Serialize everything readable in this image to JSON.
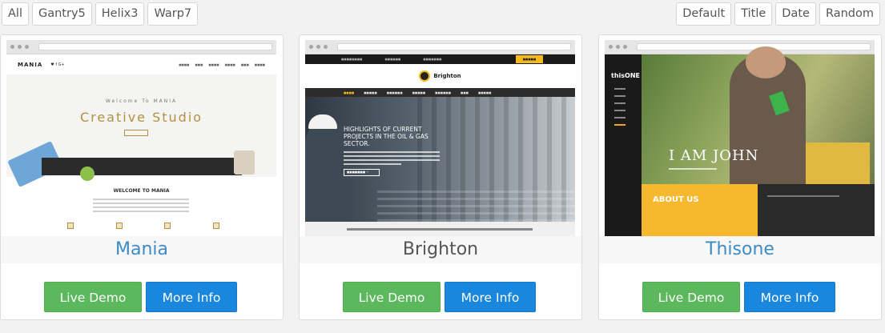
{
  "filters": {
    "left": [
      "All",
      "Gantry5",
      "Helix3",
      "Warp7"
    ],
    "right": [
      "Default",
      "Title",
      "Date",
      "Random"
    ]
  },
  "cards": [
    {
      "title": "Mania",
      "title_color": "#3d8bc5",
      "live_demo_label": "Live Demo",
      "more_info_label": "More Info",
      "thumb": {
        "logo": "MANIA",
        "welcome": "Welcome To MANIA",
        "headline": "Creative Studio",
        "section": "WELCOME TO MANIA"
      }
    },
    {
      "title": "Brighton",
      "title_color": "#555555",
      "live_demo_label": "Live Demo",
      "more_info_label": "More Info",
      "thumb": {
        "logo": "Brighton",
        "headline": "HIGHLIGHTS OF CURRENT PROJECTS IN THE OIL & GAS SECTOR."
      }
    },
    {
      "title": "Thisone",
      "title_color": "#3d8bc5",
      "live_demo_label": "Live Demo",
      "more_info_label": "More Info",
      "thumb": {
        "logo": "thisONE",
        "headline": "I AM JOHN",
        "section": "ABOUT US"
      }
    }
  ],
  "colors": {
    "live_demo": "#5cb85c",
    "more_info": "#1a87de"
  }
}
